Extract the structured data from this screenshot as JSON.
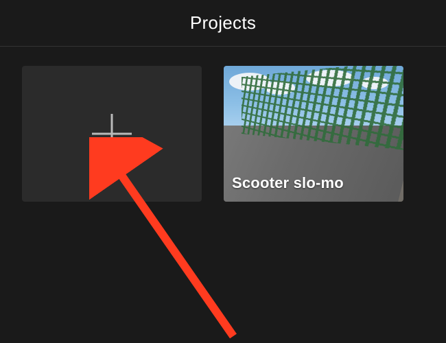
{
  "header": {
    "title": "Projects"
  },
  "new_project": {
    "icon": "plus-icon"
  },
  "projects": [
    {
      "title": "Scooter slo-mo"
    }
  ],
  "annotation": {
    "type": "arrow",
    "color": "#ff3b1f"
  }
}
